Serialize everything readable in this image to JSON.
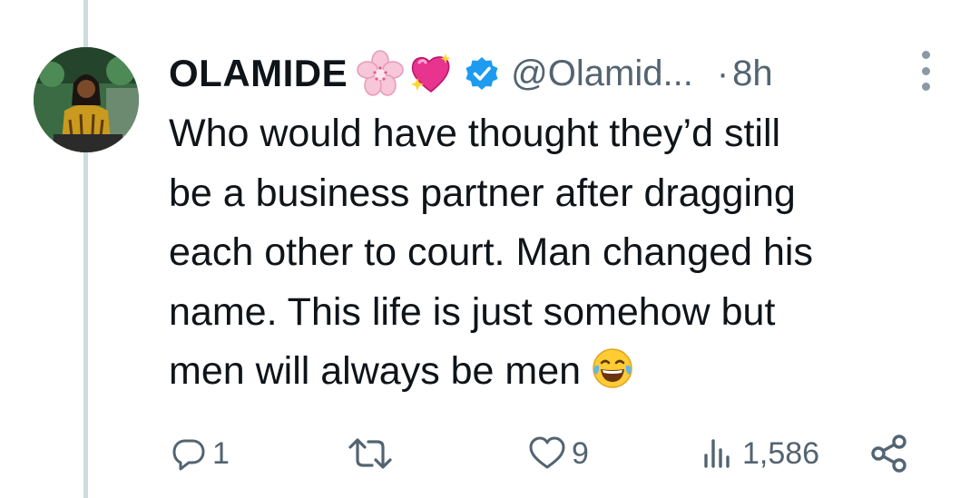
{
  "tweet": {
    "display_name": "OLAMIDE",
    "handle": "@Olamid...",
    "separator": "·",
    "time": "8h",
    "text_lines": [
      "Who would have thought they’d still",
      "be a business partner after dragging",
      "each other to court. Man changed his",
      "name. This life is just somehow but",
      "men will always be men"
    ],
    "trailing_emoji": "face-with-tears-of-joy-icon",
    "name_emojis": [
      "cherry-blossom-icon",
      "sparkling-heart-icon"
    ],
    "verified": true
  },
  "actions": {
    "replies": "1",
    "retweets": "",
    "likes": "9",
    "views": "1,586"
  },
  "colors": {
    "text": "#0f1419",
    "secondary": "#536471",
    "verified": "#1d9bf0",
    "thread_line": "#cfd9de"
  }
}
